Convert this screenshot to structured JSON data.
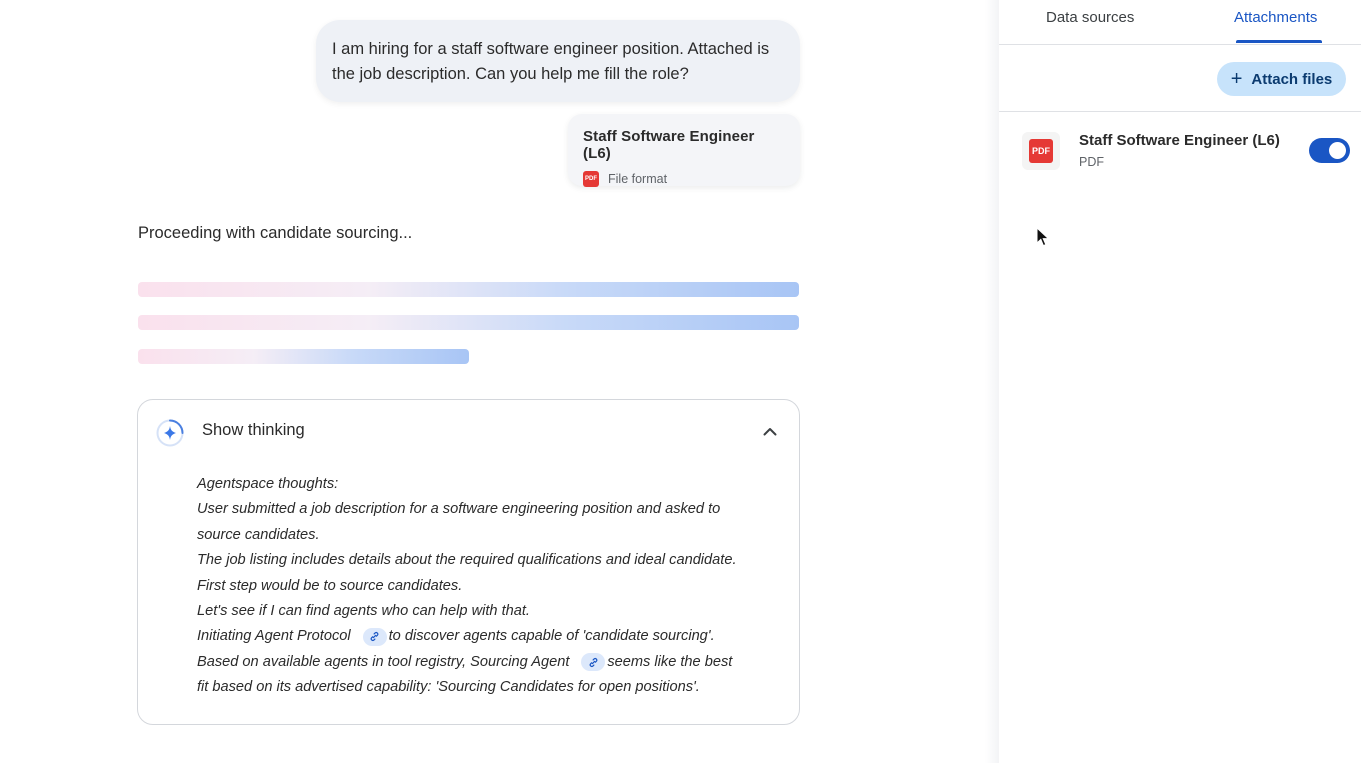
{
  "chat": {
    "user_message": "I am hiring for a staff software engineer position. Attached is the job description. Can you help me fill the role?",
    "file_card": {
      "title": "Staff Software Engineer (L6)",
      "icon": "pdf-icon",
      "icon_text": "PDF",
      "subtitle": "File format"
    },
    "status": "Proceeding with candidate sourcing...",
    "thinking": {
      "label": "Show thinking",
      "expanded": true,
      "lines": [
        "Agentspace thoughts:",
        "User submitted a job description for a software engineering position and asked to",
        "source candidates.",
        "The job listing includes details about the required qualifications and ideal candidate.",
        "First step would be to source candidates.",
        "Let's see if I can find agents who can help with that."
      ],
      "protocol_line": {
        "before": "Initiating Agent Protocol",
        "after": "to discover agents capable of 'candidate sourcing'."
      },
      "registry_line": {
        "before": "Based on available agents in tool registry, Sourcing Agent",
        "after": "seems like the best"
      },
      "last_line": "fit based on its advertised capability: 'Sourcing Candidates for open positions'."
    }
  },
  "panel": {
    "tabs": [
      {
        "label": "Data sources",
        "active": false
      },
      {
        "label": "Attachments",
        "active": true
      }
    ],
    "attach_button": "Attach files",
    "attachment": {
      "title": "Staff Software Engineer (L6)",
      "type": "PDF",
      "icon_text": "PDF",
      "enabled": true
    }
  },
  "colors": {
    "accent": "#1a56c4",
    "pdf_red": "#e53935",
    "attach_button_bg": "#c7e3fb"
  }
}
